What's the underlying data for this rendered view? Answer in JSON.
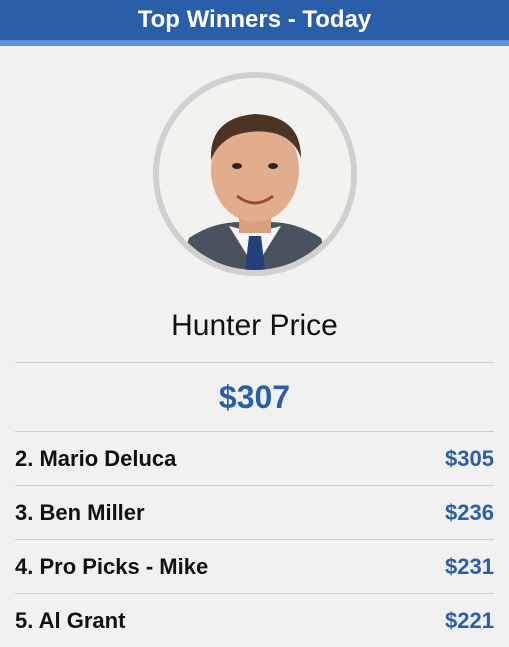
{
  "header": {
    "title": "Top Winners - Today"
  },
  "winner": {
    "name": "Hunter Price",
    "amount": "$307"
  },
  "rankings": [
    {
      "label": "2. Mario Deluca",
      "amount": "$305"
    },
    {
      "label": "3. Ben Miller",
      "amount": "$236"
    },
    {
      "label": "4. Pro Picks - Mike",
      "amount": "$231"
    },
    {
      "label": "5. Al Grant",
      "amount": "$221"
    }
  ],
  "colors": {
    "header_bg": "#2a5ea8",
    "accent": "#2a5ea8",
    "header_stripe": "#5b92d6"
  }
}
